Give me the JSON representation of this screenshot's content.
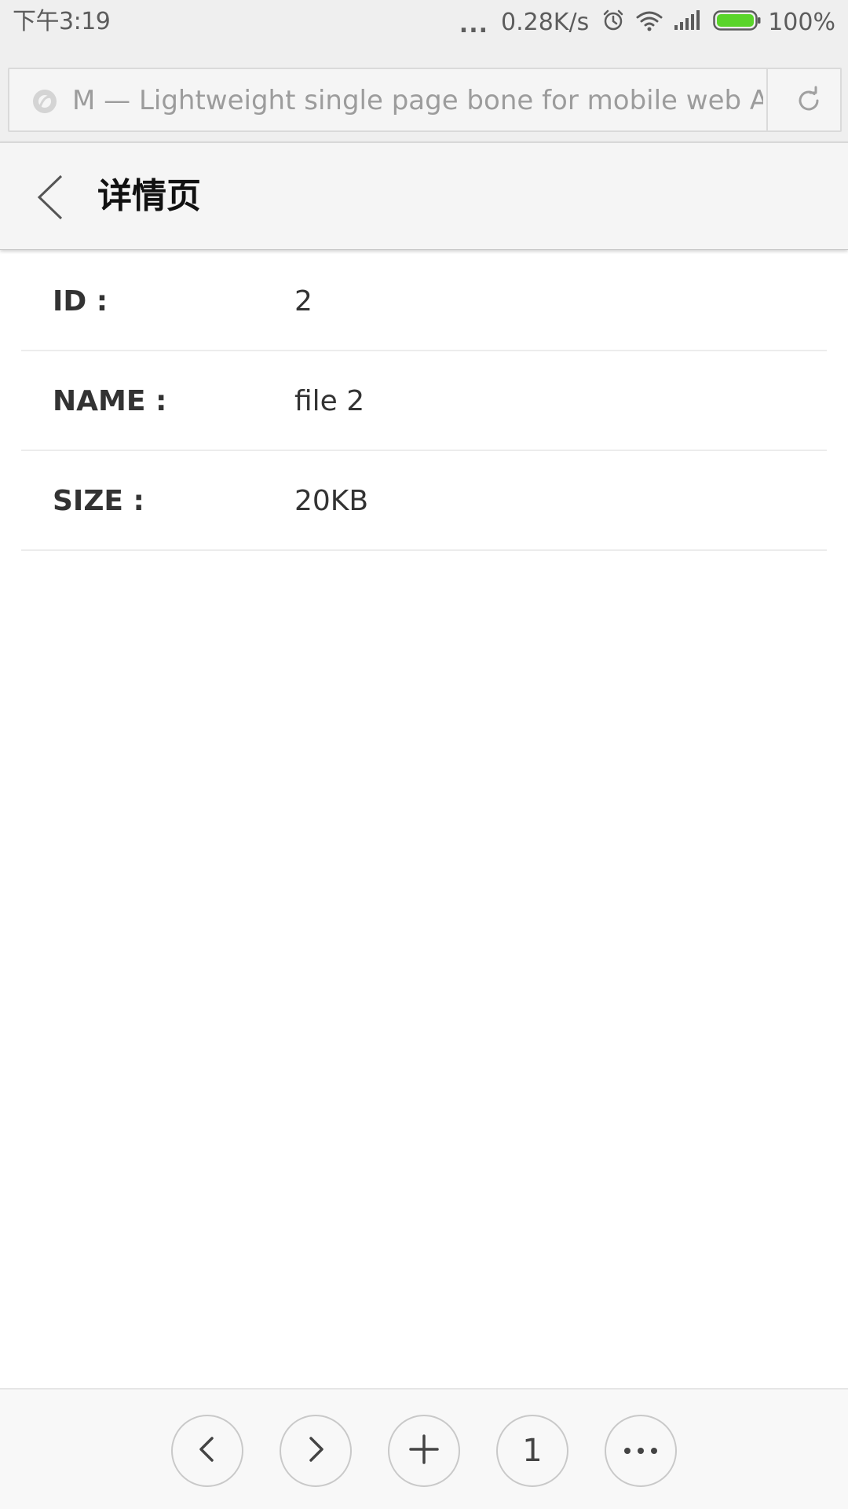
{
  "status_bar": {
    "time": "下午3:19",
    "dots": "...",
    "speed": "0.28K/s",
    "battery_percent": "100%",
    "battery_color": "#5ad42a",
    "icons": [
      "alarm-icon",
      "wifi-icon",
      "signal-icon",
      "battery-icon"
    ]
  },
  "address_bar": {
    "url_text": "M — Lightweight single page bone for mobile web App",
    "icons": [
      "site-icon",
      "reload-icon"
    ]
  },
  "header": {
    "title": "详情页",
    "back_icon": "chevron-left-icon"
  },
  "details": [
    {
      "label": "ID :",
      "value": "2"
    },
    {
      "label": "NAME :",
      "value": "file 2"
    },
    {
      "label": "SIZE :",
      "value": "20KB"
    }
  ],
  "bottom_bar": {
    "buttons": [
      "back-icon",
      "forward-icon",
      "plus-icon",
      "tabs",
      "more-icon"
    ],
    "tabs_count": "1"
  }
}
